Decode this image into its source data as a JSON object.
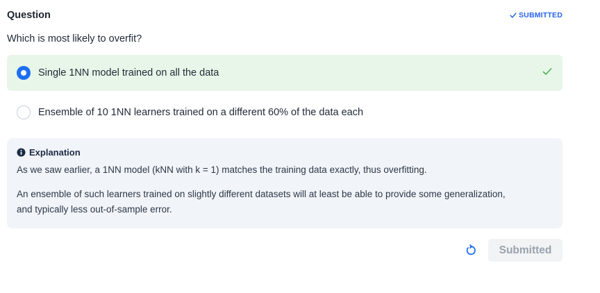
{
  "header": {
    "title": "Question",
    "status": "SUBMITTED",
    "status_icon": "check-icon"
  },
  "question": {
    "text": "Which is most likely to overfit?"
  },
  "options": [
    {
      "label": "Single 1NN model trained on all the data",
      "selected": true,
      "correct": true
    },
    {
      "label": "Ensemble of 10 1NN learners trained on a different 60% of the data each",
      "selected": false,
      "correct": false
    }
  ],
  "explanation": {
    "heading": "Explanation",
    "icon": "info-icon",
    "paragraphs": [
      "As we saw earlier, a 1NN model (kNN with k = 1) matches the training data exactly, thus overfitting.",
      "An ensemble of such learners trained on slightly different datasets will at least be able to provide some generalization, and typically less out-of-sample error."
    ]
  },
  "actions": {
    "reset_icon": "reset-icon",
    "submit_label": "Submitted",
    "submit_disabled": true
  },
  "colors": {
    "accent": "#1d6ff2",
    "status": "#2563eb",
    "correct_bg": "#e8f6e9",
    "correct_check": "#4caf50",
    "explanation_bg": "#f1f4f8"
  }
}
